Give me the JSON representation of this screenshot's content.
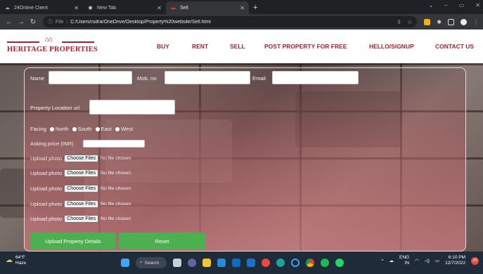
{
  "browser": {
    "tabs": [
      {
        "title": "24Online Client",
        "active": false
      },
      {
        "title": "New Tab",
        "active": false
      },
      {
        "title": "Sell",
        "active": true
      }
    ],
    "file_label": "File",
    "url": "C:/Users/rudra/OneDrive/Desktop/Property%20website/Sell.html"
  },
  "site": {
    "logo_text": "HERITAGE PROPERTIES",
    "menu": [
      "BUY",
      "RENT",
      "SELL",
      "POST PROPERTY FOR FREE",
      "HELLO/SIGNUP",
      "CONTACT US"
    ],
    "brand_color": "#b11d2b"
  },
  "form": {
    "name_label": "Name",
    "mob_label": "Mob. no",
    "email_label": "Email",
    "location_label": "Property Location url",
    "facing_label": "Facing",
    "facing_options": [
      "North",
      "South",
      "East",
      "West"
    ],
    "price_label": "Asking price (INR)",
    "upload_label": "Upload photo",
    "choose_label": "Choose Files",
    "no_file": "No file chosen",
    "submit_label": "Upload Property Details",
    "reset_label": "Reset",
    "button_color": "#4caf50"
  },
  "taskbar": {
    "temperature": "64°F",
    "condition": "Haze",
    "search_label": "Search",
    "lang": "ENG",
    "region": "IN",
    "time": "6:10 PM",
    "date": "12/7/2022",
    "notif_count": "23"
  }
}
